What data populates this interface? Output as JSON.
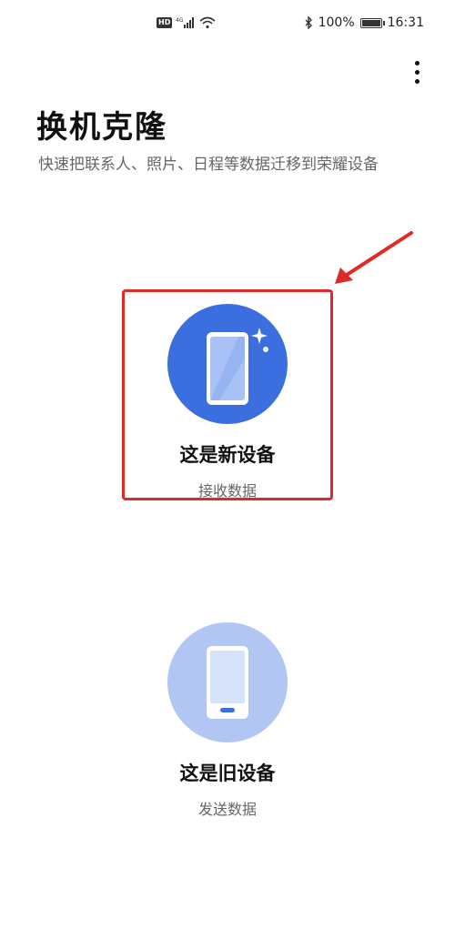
{
  "status_bar": {
    "hd": "HD",
    "network": "4G",
    "battery_level": "100%",
    "time": "16:31"
  },
  "header": {
    "title": "换机克隆",
    "subtitle": "快速把联系人、照片、日程等数据迁移到荣耀设备"
  },
  "options": {
    "new_device": {
      "title": "这是新设备",
      "subtitle": "接收数据",
      "icon": "new-phone-icon"
    },
    "old_device": {
      "title": "这是旧设备",
      "subtitle": "发送数据",
      "icon": "old-phone-icon"
    }
  },
  "colors": {
    "accent_new": "#3b6fe0",
    "accent_old": "#b1c6f3",
    "annotation_red": "#e02a2a"
  }
}
